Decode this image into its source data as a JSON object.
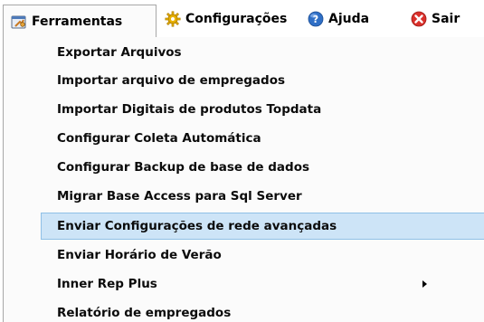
{
  "menubar": {
    "items": [
      {
        "label": "Ferramentas",
        "icon": "tools-icon",
        "open": true
      },
      {
        "label": "Configurações",
        "icon": "gear-icon"
      },
      {
        "label": "Ajuda",
        "icon": "help-icon"
      },
      {
        "label": "Sair",
        "icon": "close-icon"
      }
    ]
  },
  "dropdown": {
    "items": [
      {
        "label": "Exportar Arquivos"
      },
      {
        "label": "Importar arquivo de empregados"
      },
      {
        "label": "Importar Digitais de produtos Topdata"
      },
      {
        "label": "Configurar Coleta Automática"
      },
      {
        "label": "Configurar Backup de base de dados"
      },
      {
        "label": "Migrar Base Access para Sql Server"
      },
      {
        "label": "Enviar Configurações de rede avançadas",
        "highlighted": true
      },
      {
        "label": "Enviar Horário de Verão"
      },
      {
        "label": "Inner Rep Plus",
        "has_submenu": true
      },
      {
        "label": "Relatório de empregados"
      }
    ]
  },
  "colors": {
    "highlight_bg": "#cde4f7",
    "highlight_border": "#8fc0e6",
    "gear": "#e8b100",
    "help": "#2f6fc6",
    "exit": "#d9302b"
  }
}
